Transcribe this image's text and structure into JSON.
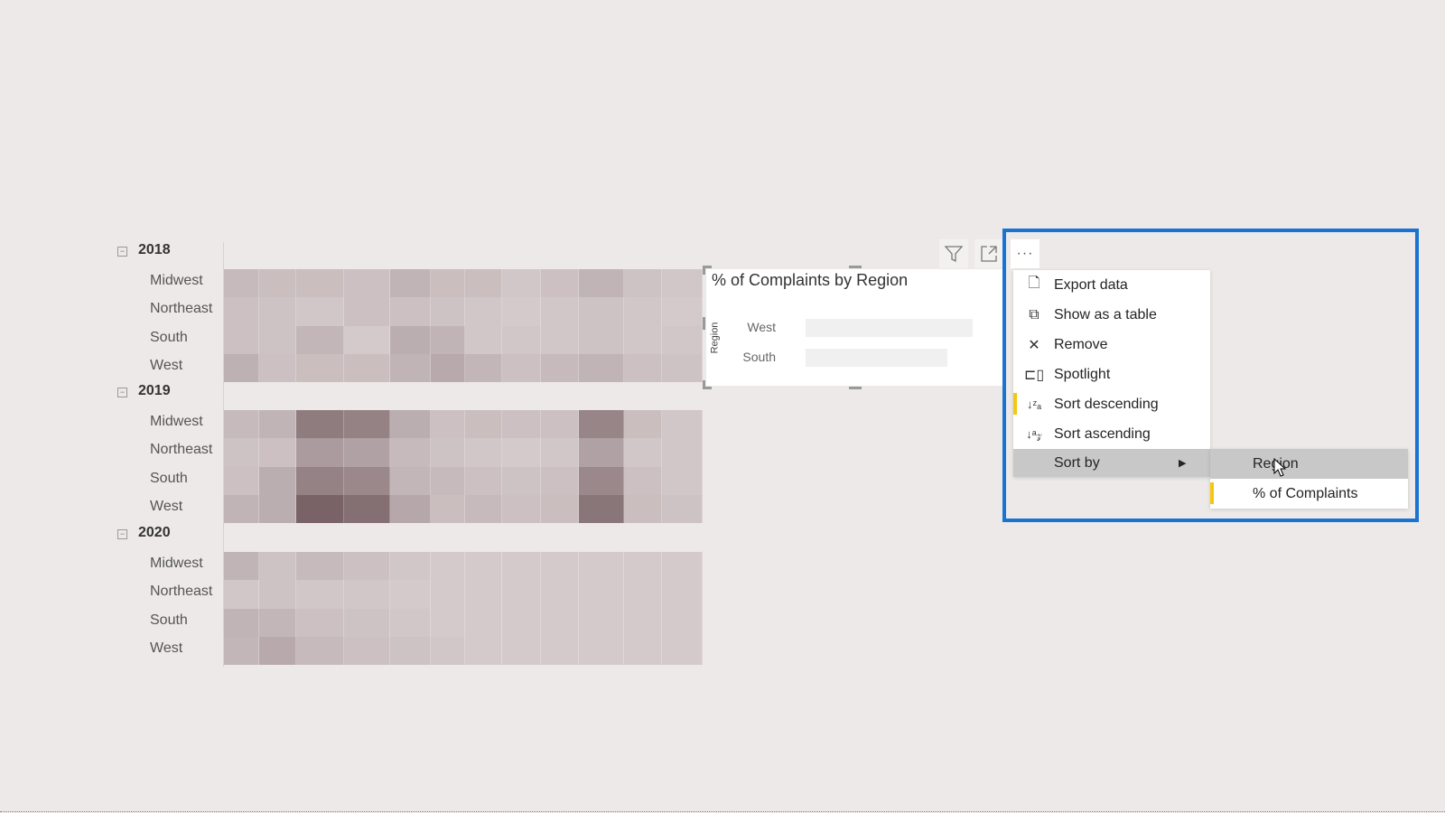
{
  "matrix": {
    "groups": [
      {
        "year": "2018",
        "rows": [
          {
            "label": "Midwest",
            "intensity": [
              0.25,
              0.22,
              0.22,
              0.2,
              0.3,
              0.22,
              0.22,
              0.15,
              0.2,
              0.3,
              0.18,
              0.15
            ]
          },
          {
            "label": "Northeast",
            "intensity": [
              0.2,
              0.18,
              0.15,
              0.2,
              0.2,
              0.18,
              0.15,
              0.12,
              0.15,
              0.18,
              0.15,
              0.12
            ]
          },
          {
            "label": "South",
            "intensity": [
              0.2,
              0.18,
              0.28,
              0.12,
              0.35,
              0.3,
              0.15,
              0.15,
              0.15,
              0.18,
              0.15,
              0.15
            ]
          },
          {
            "label": "West",
            "intensity": [
              0.32,
              0.2,
              0.22,
              0.22,
              0.3,
              0.38,
              0.28,
              0.2,
              0.25,
              0.3,
              0.2,
              0.18
            ]
          }
        ]
      },
      {
        "year": "2019",
        "rows": [
          {
            "label": "Midwest",
            "intensity": [
              0.25,
              0.3,
              0.75,
              0.7,
              0.35,
              0.2,
              0.22,
              0.2,
              0.2,
              0.68,
              0.22,
              0.15
            ]
          },
          {
            "label": "Northeast",
            "intensity": [
              0.18,
              0.2,
              0.5,
              0.45,
              0.25,
              0.18,
              0.15,
              0.12,
              0.15,
              0.45,
              0.15,
              0.15
            ]
          },
          {
            "label": "South",
            "intensity": [
              0.2,
              0.35,
              0.7,
              0.65,
              0.28,
              0.25,
              0.2,
              0.18,
              0.2,
              0.65,
              0.2,
              0.15
            ]
          },
          {
            "label": "West",
            "intensity": [
              0.3,
              0.35,
              0.95,
              0.85,
              0.4,
              0.22,
              0.25,
              0.2,
              0.22,
              0.8,
              0.22,
              0.18
            ]
          }
        ]
      },
      {
        "year": "2020",
        "rows": [
          {
            "label": "Midwest",
            "intensity": [
              0.3,
              0.18,
              0.25,
              0.2,
              0.15,
              0.12,
              0.12,
              0.12,
              0.12,
              0.12,
              0.12,
              0.12
            ]
          },
          {
            "label": "Northeast",
            "intensity": [
              0.15,
              0.18,
              0.15,
              0.15,
              0.12,
              0.12,
              0.12,
              0.12,
              0.12,
              0.12,
              0.12,
              0.12
            ]
          },
          {
            "label": "South",
            "intensity": [
              0.3,
              0.28,
              0.2,
              0.18,
              0.15,
              0.12,
              0.12,
              0.12,
              0.12,
              0.12,
              0.12,
              0.12
            ]
          },
          {
            "label": "West",
            "intensity": [
              0.28,
              0.38,
              0.25,
              0.2,
              0.18,
              0.15,
              0.12,
              0.12,
              0.12,
              0.12,
              0.12,
              0.12
            ]
          }
        ]
      }
    ],
    "colors": {
      "low": "#e2d9da",
      "high": "#735d61"
    }
  },
  "chart_data": {
    "type": "bar",
    "orientation": "horizontal",
    "title": "% of Complaints by Region",
    "ylabel": "Region",
    "categories": [
      "West",
      "South"
    ],
    "values": [
      1.0,
      0.85
    ],
    "bar_color": "#f0f0f0"
  },
  "visual_header": {
    "icons": [
      "filter-icon",
      "focus-mode-icon",
      "more-options-icon"
    ],
    "more_label": "···"
  },
  "context_menu": {
    "items": [
      {
        "label": "Export data",
        "icon": "export-icon"
      },
      {
        "label": "Show as a table",
        "icon": "table-icon"
      },
      {
        "label": "Remove",
        "icon": "close-icon"
      },
      {
        "label": "Spotlight",
        "icon": "spotlight-icon"
      },
      {
        "label": "Sort descending",
        "icon": "sort-descending-icon",
        "selected": true
      },
      {
        "label": "Sort ascending",
        "icon": "sort-ascending-icon"
      },
      {
        "label": "Sort by",
        "icon": "",
        "submenu": true,
        "highlighted": true
      }
    ],
    "submenu": [
      {
        "label": "Region",
        "hovered": true
      },
      {
        "label": "% of Complaints",
        "selected": true
      }
    ]
  },
  "colors": {
    "highlight_box": "#1874d2",
    "selected_marker": "#f2c811",
    "background": "#ede9e8"
  }
}
